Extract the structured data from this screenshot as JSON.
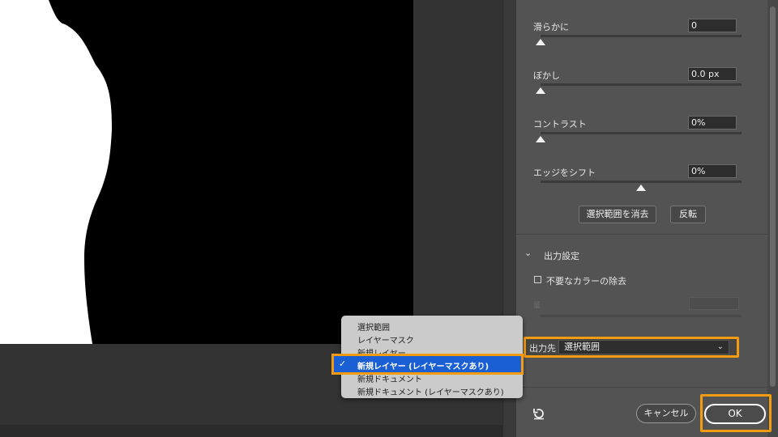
{
  "panel": {
    "sliders": [
      {
        "label": "滑らかに",
        "value": "0",
        "level": 0
      },
      {
        "label": "ぼかし",
        "value": "0.0 px",
        "level": 0
      },
      {
        "label": "コントラスト",
        "value": "0%",
        "level": 0
      },
      {
        "label": "エッジをシフト",
        "value": "0%",
        "level": 0.5
      }
    ],
    "clear_selection_label": "選択範囲を消去",
    "invert_label": "反転",
    "output_section": {
      "title": "出力設定",
      "decontaminate_label": "不要なカラーの除去",
      "amount_label": "量",
      "output_to_label": "出力先",
      "output_to_value": "選択範囲"
    },
    "cancel_label": "キャンセル",
    "ok_label": "OK"
  },
  "menu": {
    "items": [
      "選択範囲",
      "レイヤーマスク",
      "新規レイヤー"
    ],
    "selected": "新規レイヤー (レイヤーマスクあり)",
    "items_after": [
      "新規ドキュメント",
      "新規ドキュメント (レイヤーマスクあり)"
    ]
  },
  "colors": {
    "highlight": "#f39c12",
    "menu_selection": "#1a5fd3"
  }
}
